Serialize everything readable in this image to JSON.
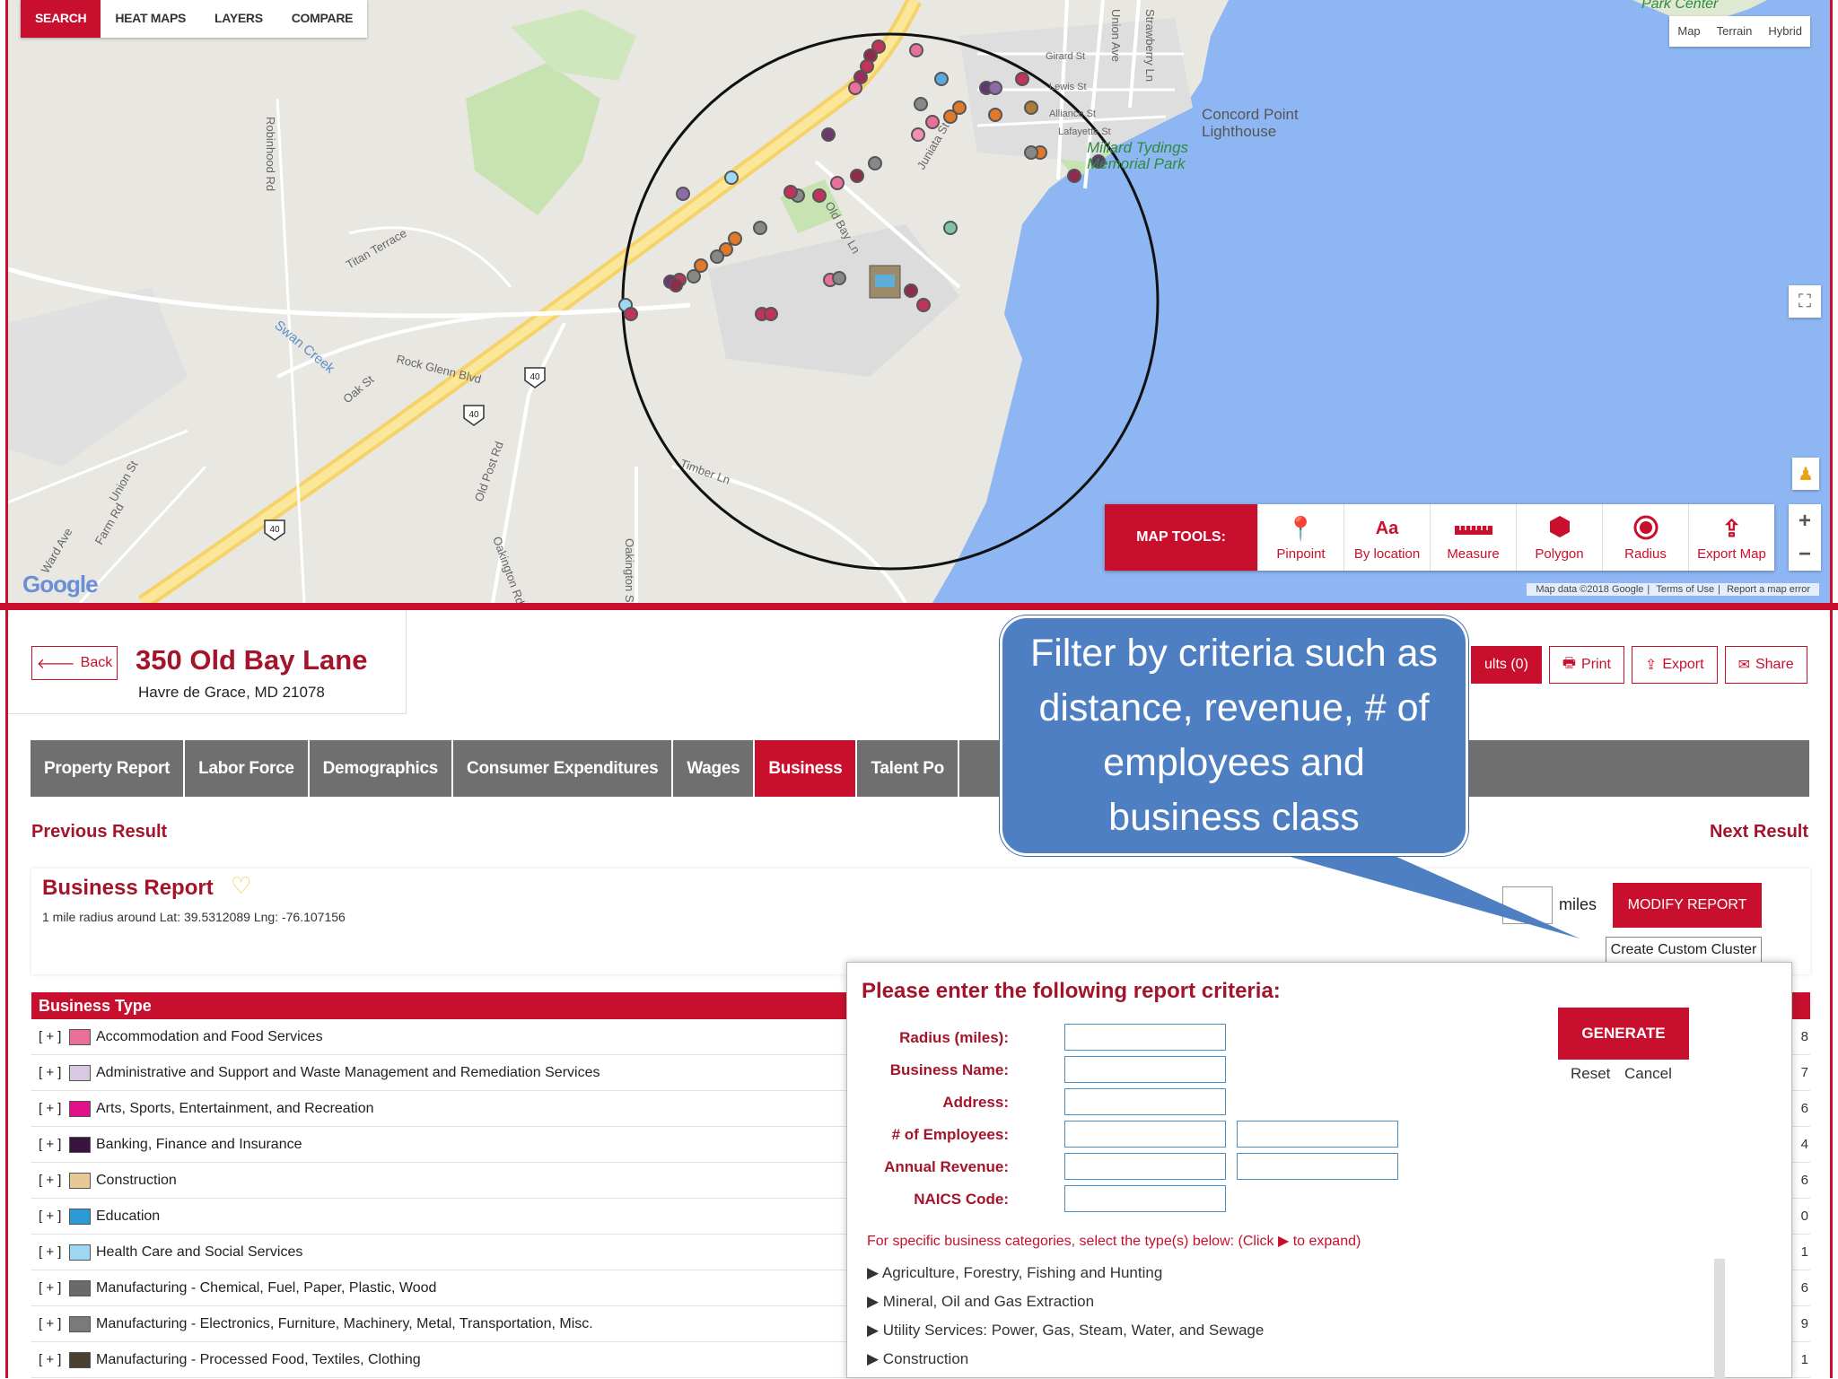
{
  "map": {
    "search_tabs": [
      "SEARCH",
      "HEAT MAPS",
      "LAYERS",
      "COMPARE"
    ],
    "map_types": [
      "Map",
      "Terrain",
      "Hybrid"
    ],
    "labels": {
      "lighthouse": "Concord Point Lighthouse",
      "park": "Millard Tydings Memorial Park",
      "park_center": "Park Center",
      "roads": [
        "Timber Ln",
        "Rock Glenn Blvd",
        "Oak St",
        "Swan Creek",
        "Titan Terrace",
        "Old Bay Ln",
        "Juniata St",
        "Union Ave",
        "Lewis St",
        "Alliance St",
        "Lafayette St",
        "Girard St",
        "Strawberry Ln",
        "Robinhood Rd",
        "Old Post Rd",
        "Oakington Rd",
        "Oakington St",
        "Union St",
        "Farm Rd",
        "Ward Ave"
      ],
      "route": "40"
    },
    "tools_label": "MAP TOOLS:",
    "tools": [
      {
        "icon": "pin-icon",
        "label": "Pinpoint"
      },
      {
        "icon": "text-icon",
        "label": "By location"
      },
      {
        "icon": "ruler-icon",
        "label": "Measure"
      },
      {
        "icon": "hexagon-icon",
        "label": "Polygon"
      },
      {
        "icon": "radius-icon",
        "label": "Radius"
      },
      {
        "icon": "export-icon",
        "label": "Export Map"
      }
    ],
    "google": "Google",
    "attribution": [
      "Map data ©2018 Google",
      "Terms of Use",
      "Report a map error"
    ]
  },
  "property": {
    "back_label": "Back",
    "address_line1": "350 Old Bay Lane",
    "address_line2": "Havre de Grace, MD 21078",
    "results_label": "ults (0)",
    "print_label": "Print",
    "export_label": "Export",
    "share_label": "Share"
  },
  "tabs": [
    "Property Report",
    "Labor Force",
    "Demographics",
    "Consumer Expenditures",
    "Wages",
    "Business",
    "Talent Po"
  ],
  "active_tab": "Business",
  "nav": {
    "previous": "Previous Result",
    "next": "Next Result"
  },
  "business_report": {
    "title": "Business Report",
    "subtitle": "1 mile radius around Lat: 39.5312089 Lng: -76.107156",
    "miles_label": "miles",
    "modify_label": "MODIFY REPORT",
    "cluster_label": "Create Custom Cluster",
    "table_header": "Business Type",
    "rows": [
      {
        "label": "Accommodation and Food Services",
        "color": "#e8709a",
        "tail": "8"
      },
      {
        "label": "Administrative and Support and Waste Management and Remediation Services",
        "color": "#d9c9e0",
        "tail": "7"
      },
      {
        "label": "Arts, Sports, Entertainment, and Recreation",
        "color": "#e0118a",
        "tail": "6"
      },
      {
        "label": "Banking, Finance and Insurance",
        "color": "#3b1340",
        "tail": "4"
      },
      {
        "label": "Construction",
        "color": "#e8c896",
        "tail": "6"
      },
      {
        "label": "Education",
        "color": "#2a9bd6",
        "tail": "0"
      },
      {
        "label": "Health Care and Social Services",
        "color": "#9fd8f2",
        "tail": "1"
      },
      {
        "label": "Manufacturing - Chemical, Fuel, Paper, Plastic, Wood",
        "color": "#6a6a6a",
        "tail": "6"
      },
      {
        "label": "Manufacturing - Electronics, Furniture, Machinery, Metal, Transportation, Misc.",
        "color": "#7a7a7a",
        "tail": "9"
      },
      {
        "label": "Manufacturing - Processed Food, Textiles, Clothing",
        "color": "#4a4030",
        "tail": "1"
      }
    ]
  },
  "criteria": {
    "title": "Please enter the following report criteria:",
    "fields": [
      "Radius (miles):",
      "Business Name:",
      "Address:",
      "# of Employees:",
      "Annual Revenue:",
      "NAICS Code:"
    ],
    "generate_label": "GENERATE",
    "reset_label": "Reset",
    "cancel_label": "Cancel",
    "note": "For specific business categories, select the type(s) below: (Click ▶ to expand)",
    "categories": [
      "▶ Agriculture, Forestry, Fishing and Hunting",
      "▶ Mineral, Oil and Gas Extraction",
      "▶ Utility Services: Power, Gas, Steam, Water, and Sewage",
      "▶ Construction"
    ]
  },
  "callout": "Filter by criteria such as distance, revenue, # of employees and business class",
  "colors": {
    "brand_red": "#c8102e",
    "callout_blue": "#4d7fc2",
    "tab_gray": "#6f6f6f",
    "water": "#8eb6f2"
  }
}
